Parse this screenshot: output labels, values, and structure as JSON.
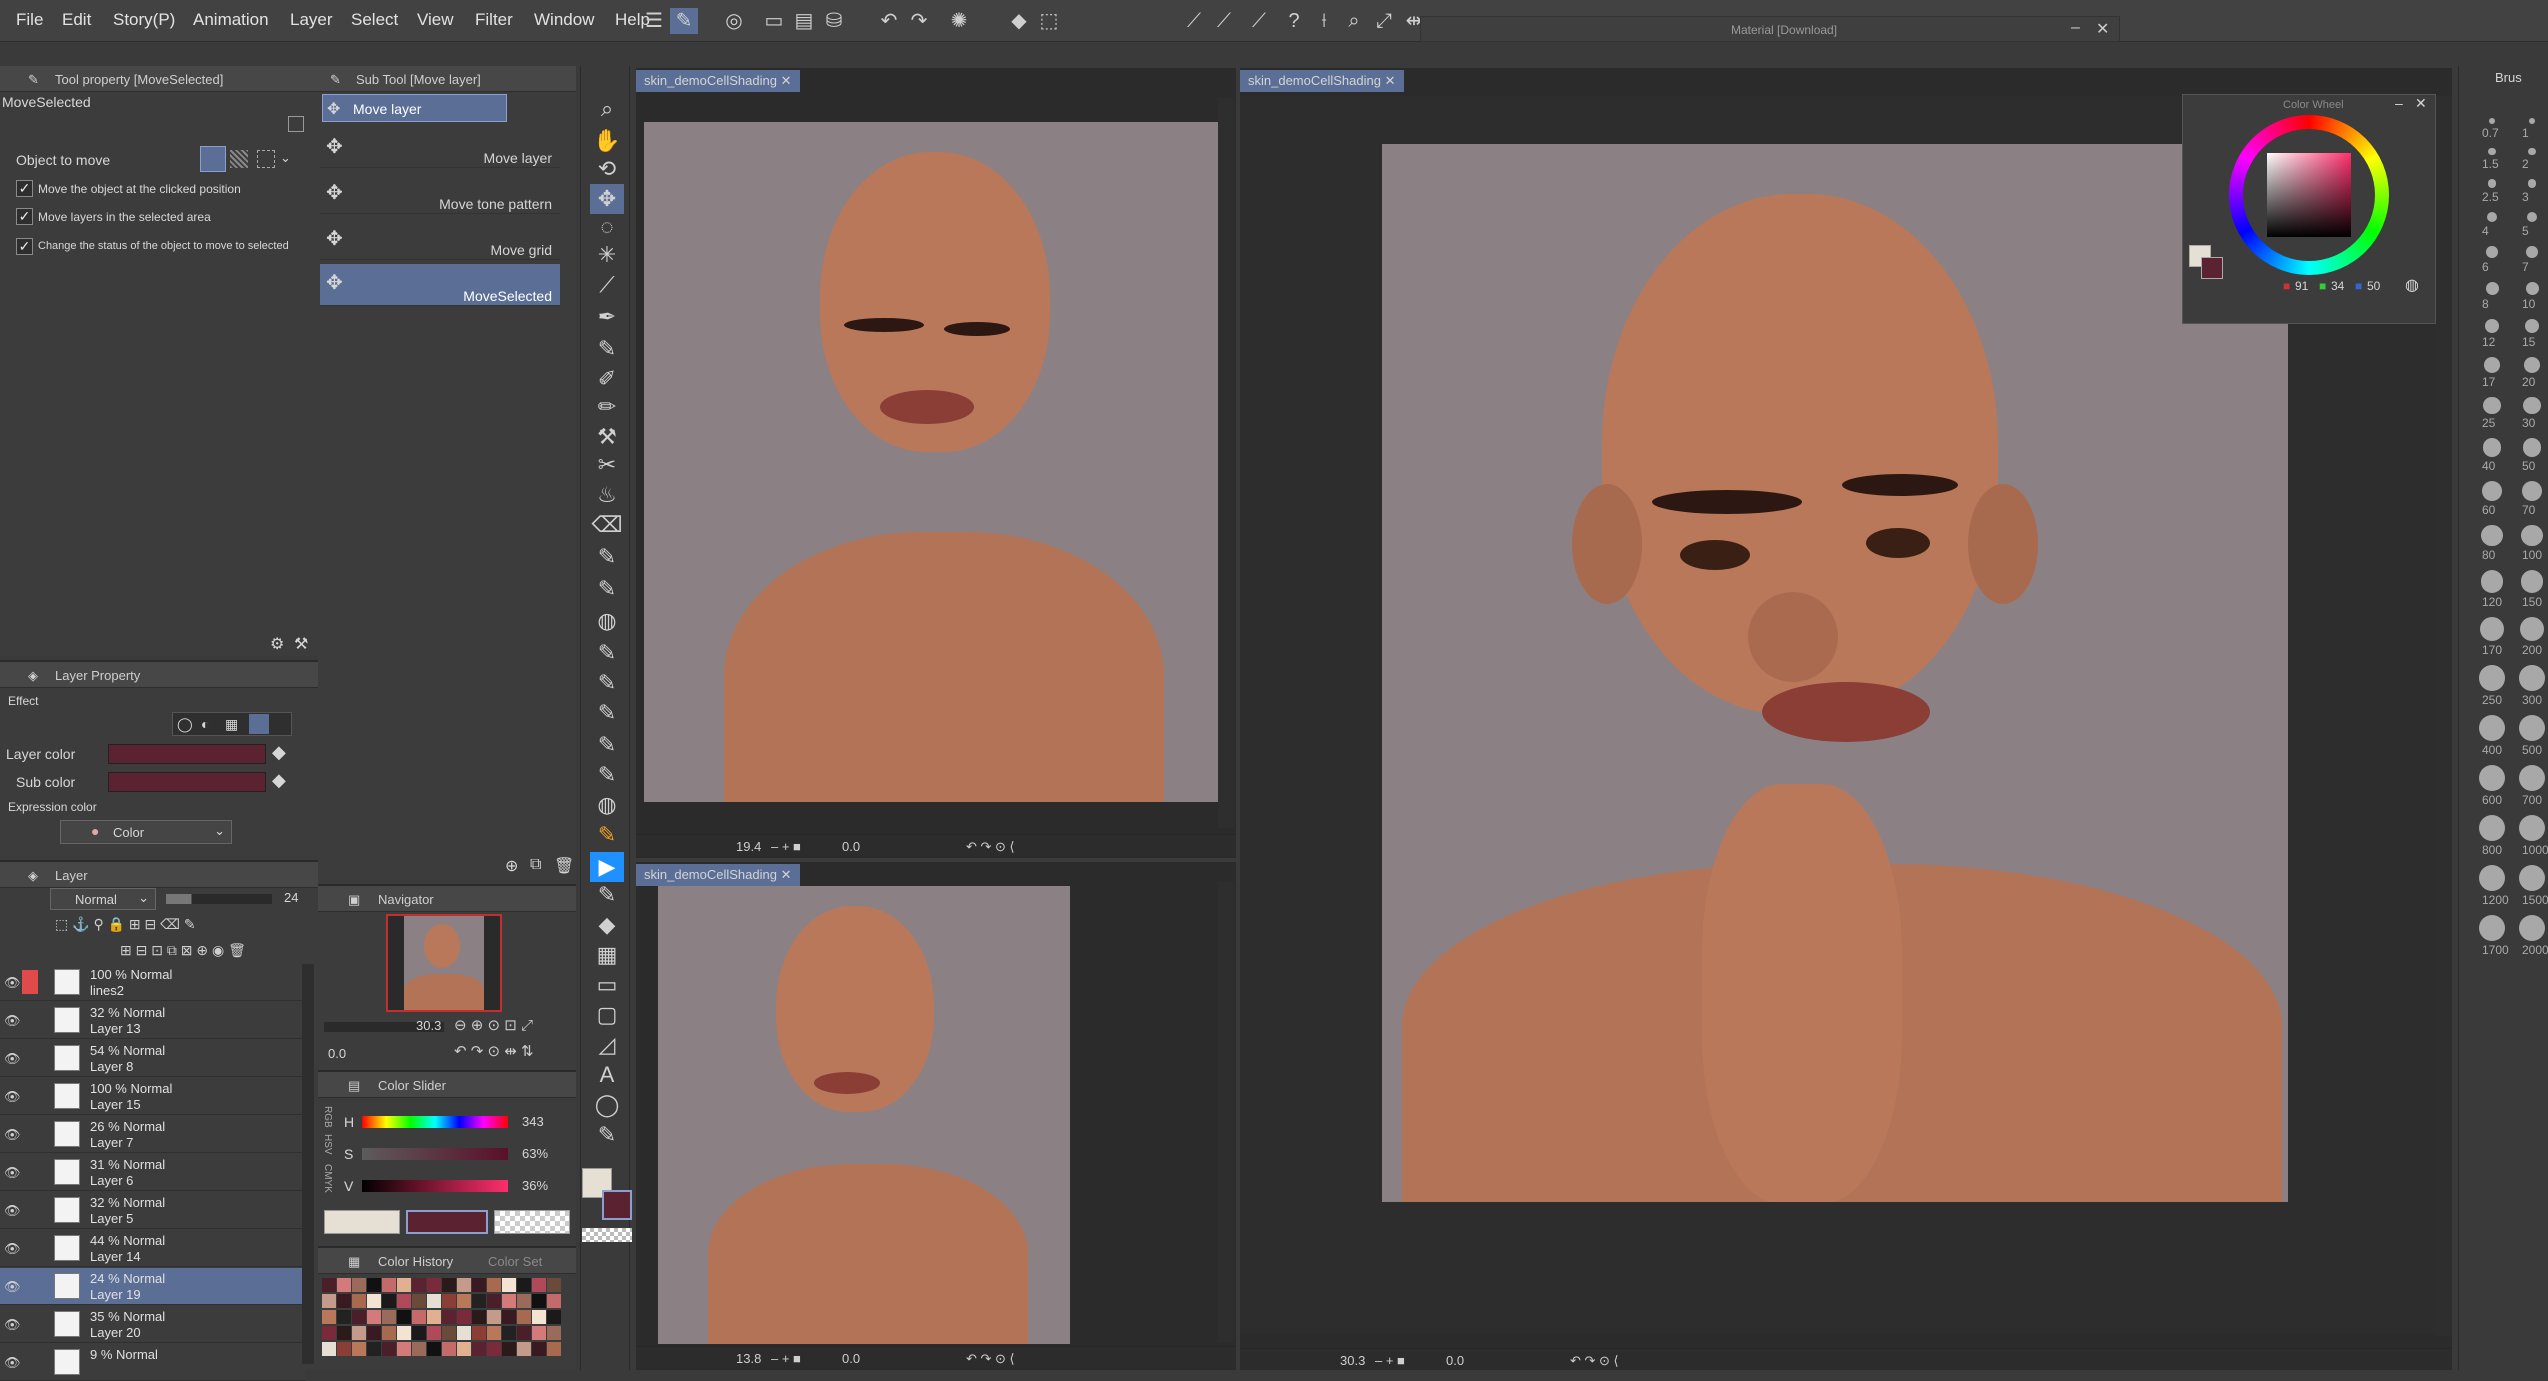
{
  "menu": [
    "File",
    "Edit",
    "Story(P)",
    "Animation",
    "Layer",
    "Select",
    "View",
    "Filter",
    "Window",
    "Help"
  ],
  "material_window_title": "Material [Download]",
  "tool_property": {
    "title": "Tool property [MoveSelected]",
    "name": "MoveSelected",
    "object_to_move_label": "Object to move",
    "options": [
      "Move the object at the clicked position",
      "Move layers in the selected area",
      "Change the status of the object to move to selected"
    ]
  },
  "sub_tool": {
    "title": "Sub Tool [Move layer]",
    "group_tab": "Move layer",
    "items": [
      "Move layer",
      "Move tone pattern",
      "Move grid",
      "MoveSelected"
    ]
  },
  "layer_property": {
    "title": "Layer Property",
    "effect_label": "Effect",
    "layer_color_label": "Layer color",
    "sub_color_label": "Sub color",
    "expression_color_label": "Expression color",
    "expression_color_value": "Color"
  },
  "layer_panel": {
    "title": "Layer",
    "blend_mode": "Normal",
    "opacity": "24",
    "layers": [
      {
        "mode": "100 % Normal",
        "name": "lines2"
      },
      {
        "mode": "32 % Normal",
        "name": "Layer 13"
      },
      {
        "mode": "54 % Normal",
        "name": "Layer 8"
      },
      {
        "mode": "100 % Normal",
        "name": "Layer 15"
      },
      {
        "mode": "26 % Normal",
        "name": "Layer 7"
      },
      {
        "mode": "31 % Normal",
        "name": "Layer 6"
      },
      {
        "mode": "32 % Normal",
        "name": "Layer 5"
      },
      {
        "mode": "44 % Normal",
        "name": "Layer 14"
      },
      {
        "mode": "24 % Normal",
        "name": "Layer 19"
      },
      {
        "mode": "35 % Normal",
        "name": "Layer 20"
      },
      {
        "mode": "9 % Normal",
        "name": ""
      }
    ]
  },
  "navigator": {
    "title": "Navigator",
    "zoom": "30.3",
    "rotation": "0.0"
  },
  "color_slider": {
    "title": "Color Slider",
    "modes": [
      "RGB",
      "HSV",
      "CMYK"
    ],
    "h_label": "H",
    "h_value": "343",
    "s_label": "S",
    "s_value": "63%",
    "v_label": "V",
    "v_value": "36%"
  },
  "color_history": {
    "title": "Color History",
    "tab2": "Color Set"
  },
  "canvas_tabs": {
    "top_left": "skin_demoCellShading",
    "bottom_left": "skin_demoCellShading",
    "right": "skin_demoCellShading"
  },
  "canvas_status": {
    "top_left_zoom": "19.4",
    "top_left_rot": "0.0",
    "bottom_left_zoom": "13.8",
    "bottom_left_rot": "0.0",
    "right_zoom": "30.3",
    "right_rot": "0.0"
  },
  "color_wheel": {
    "title": "Color Wheel",
    "r": "91",
    "g": "34",
    "b": "50"
  },
  "brush_size": {
    "title": "Brus",
    "sizes": [
      "0.7",
      "1",
      "1.5",
      "2",
      "2.5",
      "3",
      "4",
      "5",
      "6",
      "7",
      "8",
      "10",
      "12",
      "15",
      "17",
      "20",
      "25",
      "30",
      "40",
      "50",
      "60",
      "70",
      "80",
      "100",
      "120",
      "150",
      "170",
      "200",
      "250",
      "300",
      "400",
      "500",
      "600",
      "700",
      "800",
      "1000",
      "1200",
      "1500",
      "1700",
      "2000"
    ]
  },
  "colors": {
    "main": "#5b2232",
    "sub": "#e6dfd4",
    "accent": "#5a6e96",
    "skin": "#b9785a",
    "bg": "#8b8185"
  }
}
